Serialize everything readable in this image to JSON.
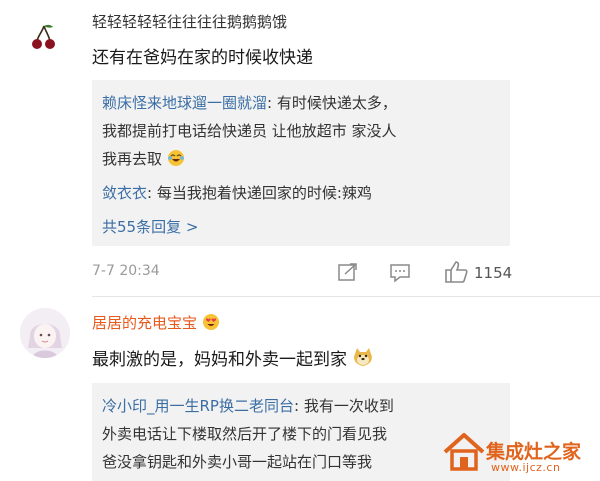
{
  "comments": [
    {
      "username": "轻轻轻轻轻往往往往鹅鹅鹅饿",
      "text": "还有在爸妈在家的时候收快递",
      "replies": [
        {
          "author": "赖床怪来地球遛一圈就溜",
          "sep": ":",
          "lines": [
            " 有时候快递太多，",
            "我都提前打电话给快递员 让他放超市 家没人",
            "我再去取"
          ],
          "emoji": "laughing-crying-emoji"
        },
        {
          "author": "敛衣衣",
          "sep": ":",
          "lines": [
            " 每当我抱着快递回家的时候:辣鸡"
          ]
        }
      ],
      "more_replies": "共55条回复 >",
      "timestamp": "7-7 20:34",
      "like_count": "1154"
    },
    {
      "username": "居居的充电宝宝",
      "text": "最刺激的是，妈妈和外卖一起到家",
      "replies": [
        {
          "author": "冷小印_用一生RP换二老同台",
          "sep": ":",
          "lines": [
            " 我有一次收到",
            "外卖电话让下楼取然后开了楼下的门看见我",
            "爸没拿钥匙和外卖小哥一起站在门口等我"
          ]
        }
      ]
    }
  ],
  "watermark": {
    "name": "集成灶之家",
    "url": "www.ijcz.cn"
  },
  "colors": {
    "link": "#3b6ea5",
    "reply_bg": "#f2f2f2",
    "meta": "#9a9a9a",
    "watermark": "#e0641e"
  }
}
